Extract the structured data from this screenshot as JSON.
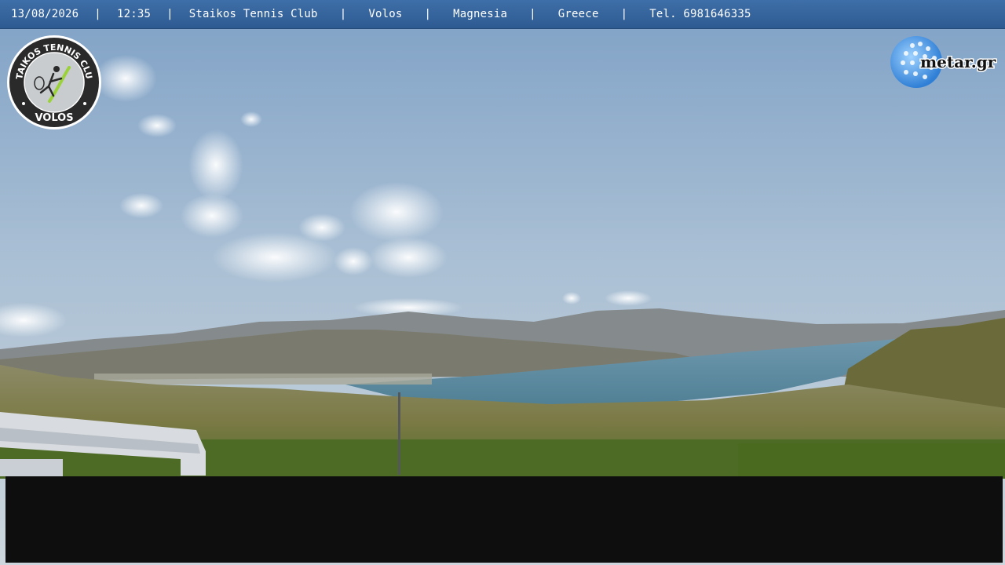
{
  "overlay": {
    "date": "13/08/2026",
    "time": "12:35",
    "club": "Staikos Tennis Club",
    "city": "Volos",
    "region": "Magnesia",
    "country": "Greece",
    "phone": "Tel. 6981646335",
    "separator": "|"
  },
  "logo": {
    "top_text": "STAIKOS TENNIS CLUB",
    "bottom_text": "VOLOS"
  },
  "watermark": {
    "text": "metar.gr"
  },
  "colors": {
    "topbar": "#2d5a91",
    "sky_top": "#7fa1c6",
    "sea": "#5f8ea2",
    "black_bar": "#0e0e0e",
    "logo_accent": "#9bd23a"
  }
}
